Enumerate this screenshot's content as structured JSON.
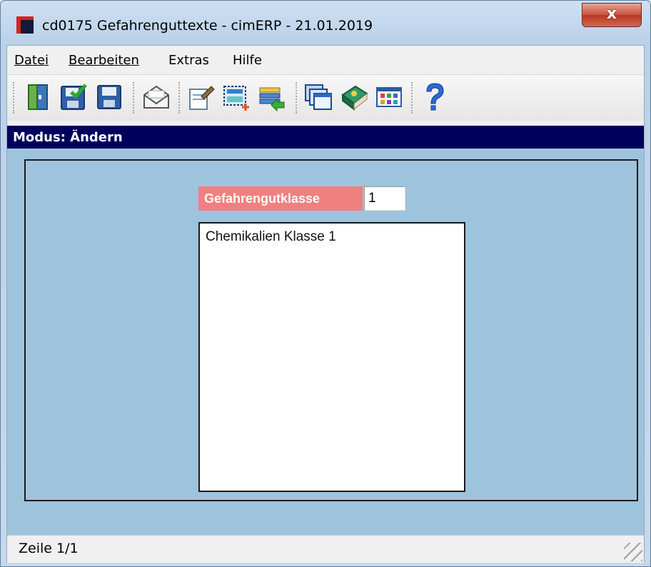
{
  "window": {
    "title": "cd0175 Gefahrenguttexte - cimERP - 21.01.2019",
    "close_label": "x"
  },
  "menu": {
    "items": [
      {
        "label": "Datei"
      },
      {
        "label": "Bearbeiten"
      },
      {
        "label": "Extras"
      },
      {
        "label": "Hilfe"
      }
    ]
  },
  "toolbar": {
    "buttons": [
      {
        "icon": "exit-door-icon"
      },
      {
        "icon": "save-confirm-icon"
      },
      {
        "icon": "save-icon"
      },
      {
        "icon": "mail-envelope-icon"
      },
      {
        "icon": "edit-document-icon"
      },
      {
        "icon": "new-record-icon"
      },
      {
        "icon": "import-list-icon"
      },
      {
        "icon": "windows-cascade-icon"
      },
      {
        "icon": "book-icon"
      },
      {
        "icon": "grid-table-icon"
      },
      {
        "icon": "help-icon"
      }
    ]
  },
  "mode": {
    "text": "Modus: Ändern"
  },
  "form": {
    "class_label": "Gefahrengutklasse",
    "class_value": "1",
    "text_value": "Chemikalien Klasse 1"
  },
  "status": {
    "text": "Zeile 1/1"
  },
  "colors": {
    "mode_bar": "#00005c",
    "content_bg": "#9ec3dc",
    "label_bg": "#f08080"
  }
}
